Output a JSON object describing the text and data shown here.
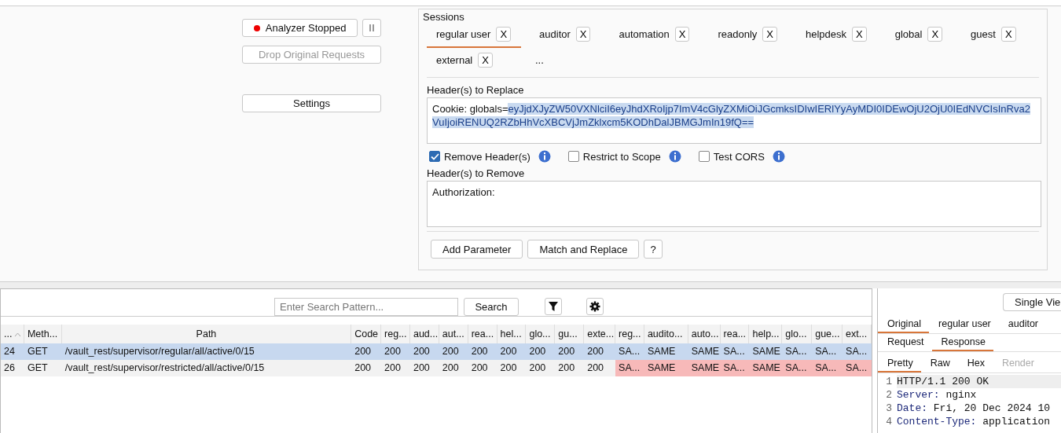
{
  "controls": {
    "analyzer_button": {
      "label": "Analyzer Stopped",
      "running": false
    },
    "drop_button": {
      "label": "Drop Original Requests",
      "disabled": true
    },
    "settings_button": {
      "label": "Settings"
    }
  },
  "sessions": {
    "title": "Sessions",
    "tabs": [
      {
        "label": "regular user",
        "selected": true,
        "close": "X"
      },
      {
        "label": "auditor",
        "selected": false,
        "close": "X"
      },
      {
        "label": "automation",
        "selected": false,
        "close": "X"
      },
      {
        "label": "readonly",
        "selected": false,
        "close": "X"
      },
      {
        "label": "helpdesk",
        "selected": false,
        "close": "X"
      },
      {
        "label": "global",
        "selected": false,
        "close": "X"
      },
      {
        "label": "guest",
        "selected": false,
        "close": "X"
      },
      {
        "label": "external",
        "selected": false,
        "close": "X"
      }
    ],
    "more_tab": "...",
    "replace_label": "Header(s) to Replace",
    "replace_value": "Cookie: globals=",
    "replace_selected": "eyJjdXJyZW50VXNlciI6eyJhdXRoIjp7ImV4cGlyZXMiOiJGcmksIDIwIERlYyAyMDI0IDEwOjU2OjU0IEdNVCIsInRva2VuIjoiRENUQ2RZbHhVcXBCVjJmZklxcm5KODhDalJBMGJmIn19fQ==",
    "options": [
      {
        "label": "Remove Header(s)",
        "checked": true
      },
      {
        "label": "Restrict to Scope",
        "checked": false
      },
      {
        "label": "Test CORS",
        "checked": false
      }
    ],
    "remove_label": "Header(s) to Remove",
    "remove_value": "Authorization:",
    "buttons": [
      "Add Parameter",
      "Match and Replace",
      "?"
    ]
  },
  "table": {
    "search": {
      "placeholder": "Enter Search Pattern...",
      "button": "Search"
    },
    "columns": [
      "...",
      "Meth...",
      "Path",
      "Code",
      "reg...",
      "aud...",
      "aut...",
      "rea...",
      "hel...",
      "glo...",
      "gu...",
      "exte...",
      "reg...",
      "audito...",
      "auto...",
      "rea...",
      "help...",
      "glo...",
      "gue...",
      "ext..."
    ],
    "rows": [
      {
        "selected": true,
        "flagged": false,
        "cells": [
          "24",
          "GET",
          "/vault_rest/supervisor/regular/all/active/0/15",
          "200",
          "200",
          "200",
          "200",
          "200",
          "200",
          "200",
          "200",
          "200",
          "SA...",
          "SAME",
          "SAME",
          "SA...",
          "SAME",
          "SA...",
          "SA...",
          "SA..."
        ]
      },
      {
        "selected": false,
        "flagged": true,
        "cells": [
          "26",
          "GET",
          "/vault_rest/supervisor/restricted/all/active/0/15",
          "200",
          "200",
          "200",
          "200",
          "200",
          "200",
          "200",
          "200",
          "200",
          "SA...",
          "SAME",
          "SAME",
          "SA...",
          "SAME",
          "SA...",
          "SA...",
          "SA..."
        ]
      }
    ]
  },
  "viewer": {
    "view_button": "Single Vie",
    "session_tabs": [
      {
        "label": "Original",
        "selected": true
      },
      {
        "label": "regular user",
        "selected": false
      },
      {
        "label": "auditor",
        "selected": false
      }
    ],
    "message_tabs": [
      {
        "label": "Request",
        "selected": false
      },
      {
        "label": "Response",
        "selected": true
      }
    ],
    "format_tabs": [
      {
        "label": "Pretty",
        "selected": true,
        "disabled": false
      },
      {
        "label": "Raw",
        "selected": false,
        "disabled": false
      },
      {
        "label": "Hex",
        "selected": false,
        "disabled": false
      },
      {
        "label": "Render",
        "selected": false,
        "disabled": true
      }
    ],
    "lines": [
      {
        "number": "1",
        "value": "HTTP/1.1 200 OK",
        "current": true
      },
      {
        "number": "2",
        "key": "Server:",
        "value": " nginx",
        "current": false
      },
      {
        "number": "3",
        "key": "Date:",
        "value": " Fri, 20 Dec 2024 10",
        "current": false
      },
      {
        "number": "4",
        "key": "Content-Type:",
        "value": " application",
        "current": false
      }
    ]
  }
}
